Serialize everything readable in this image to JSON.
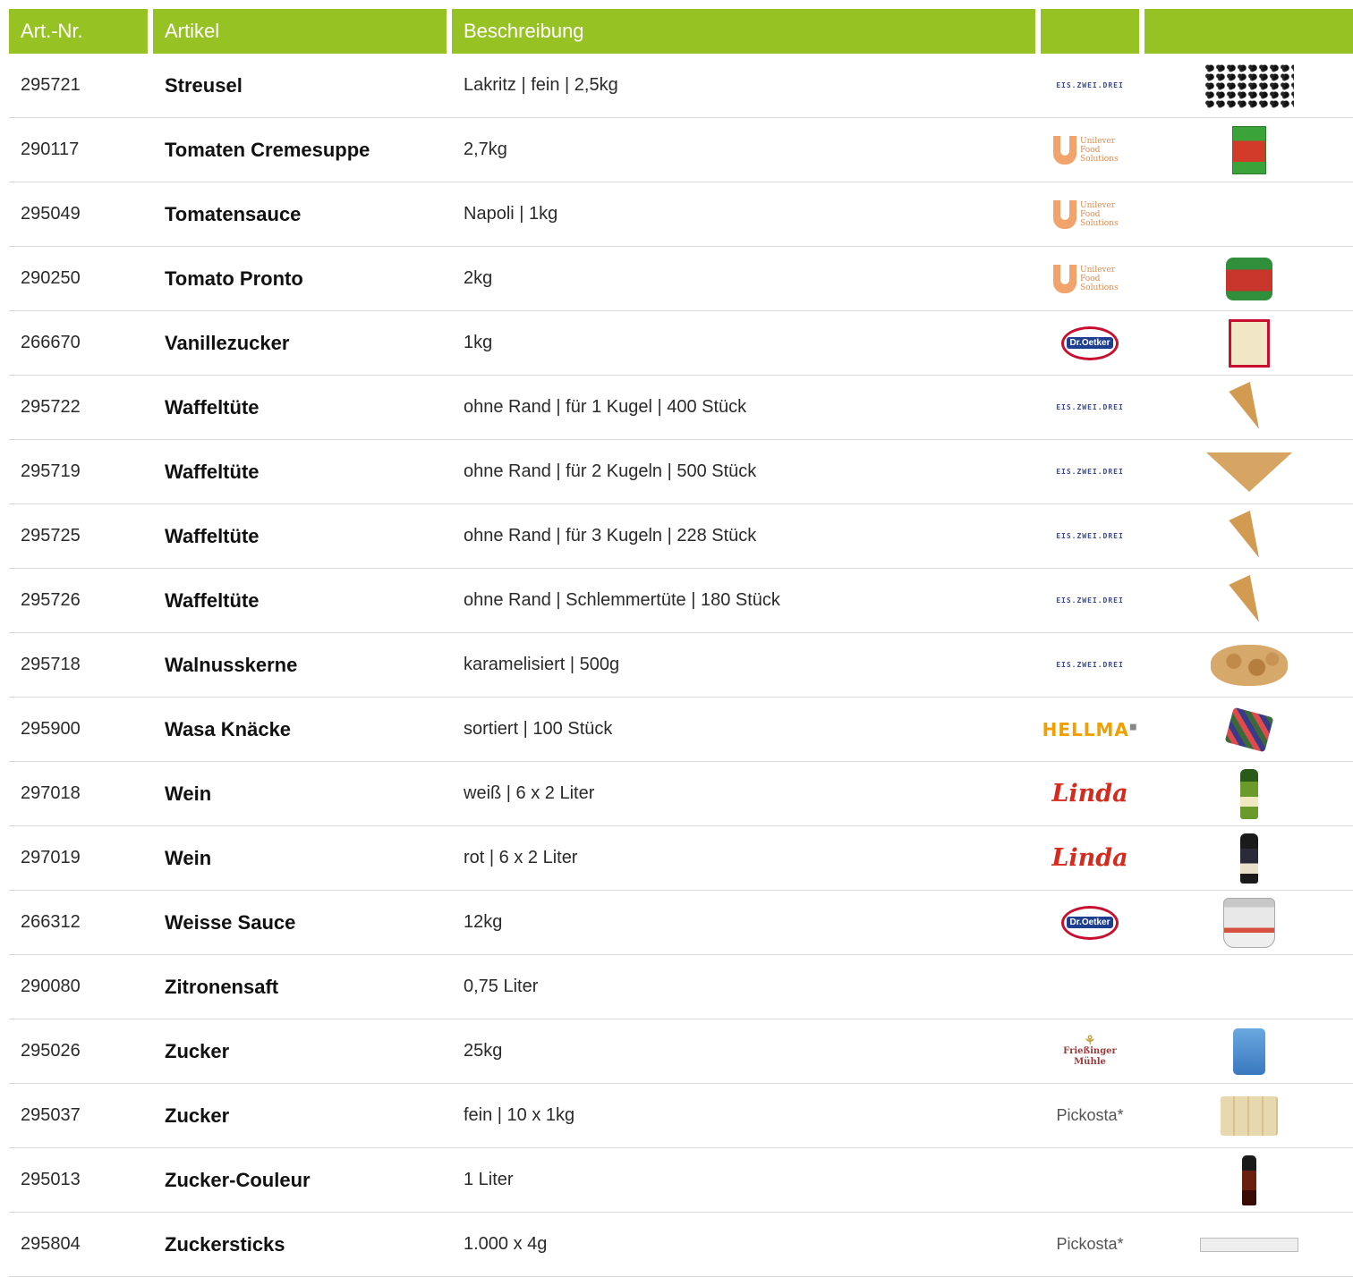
{
  "header": {
    "col_nr": "Art.-Nr.",
    "col_article": "Artikel",
    "col_description": "Beschreibung",
    "col_brand": "",
    "col_image": ""
  },
  "colors": {
    "header_bg": "#97c224",
    "header_text": "#ffffff",
    "row_divider": "#d9d9d9"
  },
  "rows": [
    {
      "nr": "295721",
      "name": "Streusel",
      "desc": "Lakritz | fein | 2,5kg",
      "brand": "eis-zwei-drei",
      "brand_text": "EIS.ZWEI.DREI",
      "product": "licorice-sprinkles-image"
    },
    {
      "nr": "290117",
      "name": "Tomaten Cremesuppe",
      "desc": "2,7kg",
      "brand": "unilever-food-solutions",
      "brand_text": "Unilever Food Solutions",
      "product": "soup-box-image"
    },
    {
      "nr": "295049",
      "name": "Tomatensauce",
      "desc": "Napoli | 1kg",
      "brand": "unilever-food-solutions",
      "brand_text": "Unilever Food Solutions",
      "product": ""
    },
    {
      "nr": "290250",
      "name": "Tomato Pronto",
      "desc": "2kg",
      "brand": "unilever-food-solutions",
      "brand_text": "Unilever Food Solutions",
      "product": "tomato-tub-image"
    },
    {
      "nr": "266670",
      "name": "Vanillezucker",
      "desc": "1kg",
      "brand": "dr-oetker",
      "brand_text": "Dr.Oetker",
      "product": "vanilla-box-image"
    },
    {
      "nr": "295722",
      "name": "Waffeltüte",
      "desc": "ohne Rand | für 1 Kugel | 400 Stück",
      "brand": "eis-zwei-drei",
      "brand_text": "EIS.ZWEI.DREI",
      "product": "cone-image"
    },
    {
      "nr": "295719",
      "name": "Waffeltüte",
      "desc": "ohne Rand | für 2 Kugeln | 500 Stück",
      "brand": "eis-zwei-drei",
      "brand_text": "EIS.ZWEI.DREI",
      "product": "wide-cone-image"
    },
    {
      "nr": "295725",
      "name": "Waffeltüte",
      "desc": "ohne Rand | für 3 Kugeln | 228 Stück",
      "brand": "eis-zwei-drei",
      "brand_text": "EIS.ZWEI.DREI",
      "product": "cone-image"
    },
    {
      "nr": "295726",
      "name": "Waffeltüte",
      "desc": "ohne Rand | Schlemmertüte | 180 Stück",
      "brand": "eis-zwei-drei",
      "brand_text": "EIS.ZWEI.DREI",
      "product": "cone-image"
    },
    {
      "nr": "295718",
      "name": "Walnusskerne",
      "desc": "karamelisiert | 500g",
      "brand": "eis-zwei-drei",
      "brand_text": "EIS.ZWEI.DREI",
      "product": "walnut-image"
    },
    {
      "nr": "295900",
      "name": "Wasa Knäcke",
      "desc": "sortiert | 100 Stück",
      "brand": "hellma",
      "brand_text": "HELLMA",
      "product": "wasa-image"
    },
    {
      "nr": "297018",
      "name": "Wein",
      "desc": "weiß | 6 x 2 Liter",
      "brand": "linda",
      "brand_text": "Linda",
      "product": "white-wine-image"
    },
    {
      "nr": "297019",
      "name": "Wein",
      "desc": "rot | 6 x 2 Liter",
      "brand": "linda",
      "brand_text": "Linda",
      "product": "red-wine-image"
    },
    {
      "nr": "266312",
      "name": "Weisse Sauce",
      "desc": "12kg",
      "brand": "dr-oetker",
      "brand_text": "Dr.Oetker",
      "product": "sauce-bucket-image"
    },
    {
      "nr": "290080",
      "name": "Zitronensaft",
      "desc": "0,75 Liter",
      "brand": "",
      "brand_text": "",
      "product": ""
    },
    {
      "nr": "295026",
      "name": "Zucker",
      "desc": "25kg",
      "brand": "friessinger-muehle",
      "brand_text": "Frießinger Mühle",
      "product": "sugar-sack-image"
    },
    {
      "nr": "295037",
      "name": "Zucker",
      "desc": "fein | 10 x 1kg",
      "brand": "pickosta",
      "brand_text": "Pickosta*",
      "product": "sugar-pallet-image"
    },
    {
      "nr": "295013",
      "name": "Zucker-Couleur",
      "desc": "1 Liter",
      "brand": "",
      "brand_text": "",
      "product": "couleur-bottle-image"
    },
    {
      "nr": "295804",
      "name": "Zuckersticks",
      "desc": "1.000 x 4g",
      "brand": "pickosta",
      "brand_text": "Pickosta*",
      "product": "sugar-stick-image"
    }
  ]
}
